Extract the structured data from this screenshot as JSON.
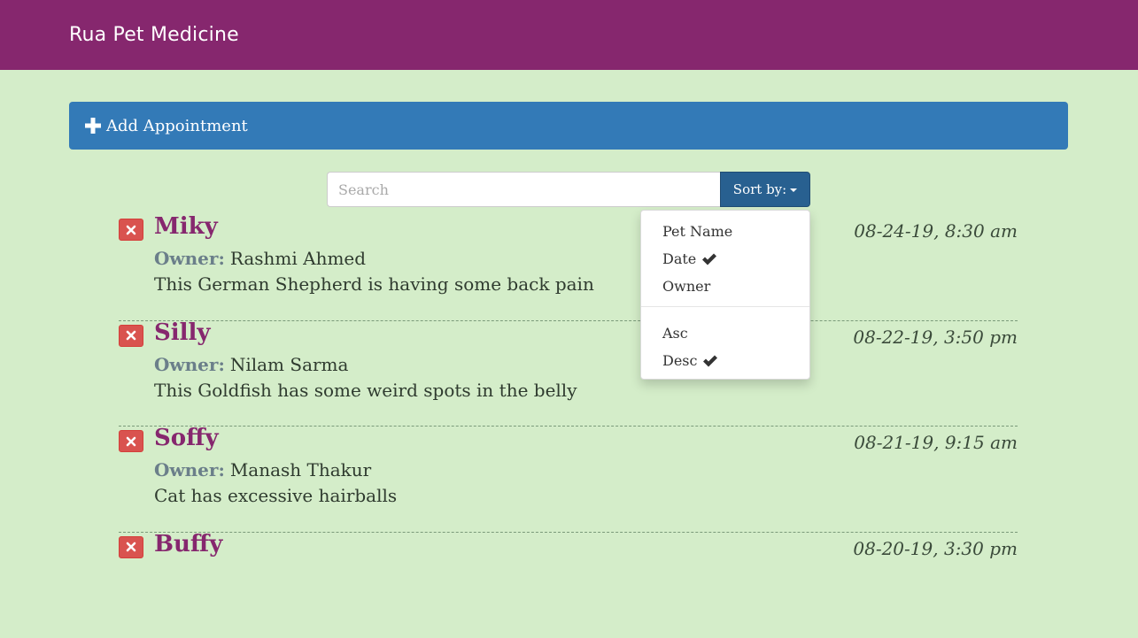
{
  "navbar": {
    "brand": "Rua Pet Medicine"
  },
  "add_panel": {
    "label": "Add Appointment",
    "icon": "plus-icon"
  },
  "search": {
    "placeholder": "Search",
    "value": ""
  },
  "sort": {
    "button_label": "Sort by:",
    "menu": {
      "fields": [
        {
          "label": "Pet Name",
          "checked": false
        },
        {
          "label": "Date",
          "checked": true
        },
        {
          "label": "Owner",
          "checked": false
        }
      ],
      "orders": [
        {
          "label": "Asc",
          "checked": false
        },
        {
          "label": "Desc",
          "checked": true
        }
      ]
    }
  },
  "appointments": [
    {
      "pet_name": "Miky",
      "owner_label": "Owner:",
      "owner": "Rashmi Ahmed",
      "notes": "This German Shepherd is having some back pain",
      "date": "08-24-19, 8:30 am"
    },
    {
      "pet_name": "Silly",
      "owner_label": "Owner:",
      "owner": "Nilam Sarma",
      "notes": "This Goldfish has some weird spots in the belly",
      "date": "08-22-19, 3:50 pm"
    },
    {
      "pet_name": "Soffy",
      "owner_label": "Owner:",
      "owner": "Manash Thakur",
      "notes": "Cat has excessive hairballs",
      "date": "08-21-19, 9:15 am"
    },
    {
      "pet_name": "Buffy",
      "owner_label": "",
      "owner": "",
      "notes": "",
      "date": "08-20-19, 3:30 pm"
    }
  ],
  "colors": {
    "navbar": "#86276e",
    "background": "#d4edc9",
    "primary": "#337ab7",
    "danger": "#d9534f",
    "pet_name": "#86276e"
  }
}
